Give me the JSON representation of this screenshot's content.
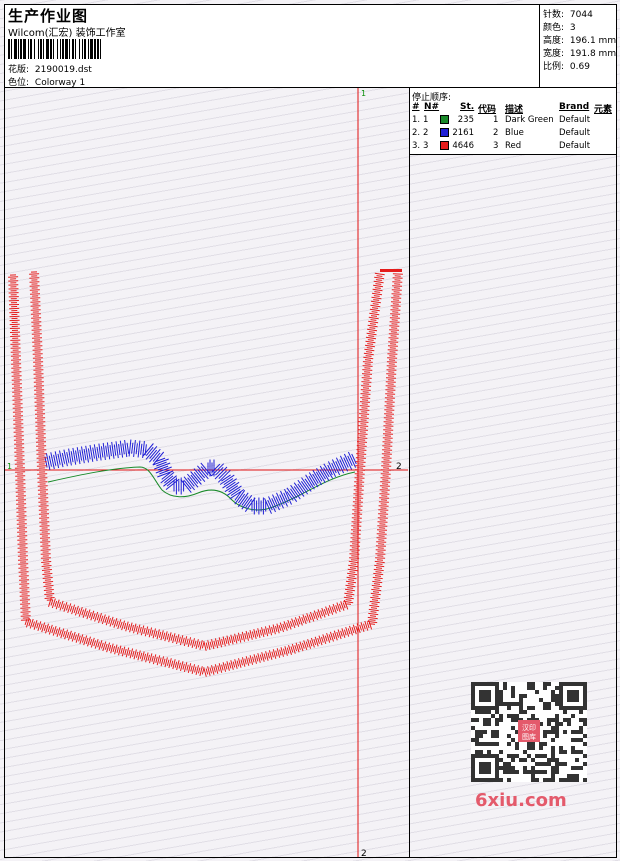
{
  "header": {
    "title": "生产作业图",
    "studio": "Wilcom(汇宏) 装饰工作室",
    "design_label": "花版:",
    "design_value": "2190019.dst",
    "colorway_label": "色位:",
    "colorway_value": "Colorway 1"
  },
  "stats": {
    "stitches_label": "针数:",
    "stitches_value": "7044",
    "colors_label": "颜色:",
    "colors_value": "3",
    "height_label": "高度:",
    "height_value": "196.1 mm",
    "width_label": "宽度:",
    "width_value": "191.8 mm",
    "scale_label": "比例:",
    "scale_value": "0.69"
  },
  "stop_sequence": {
    "title": "停止顺序:",
    "columns": {
      "index": "#",
      "needle": "N#",
      "stitches": "St.",
      "code": "代码",
      "description": "描述",
      "brand": "Brand",
      "element": "元素"
    },
    "rows": [
      {
        "index": "1.",
        "needle": "1",
        "color": "#1a8a2a",
        "stitches": "235",
        "code": "1",
        "description": "Dark Green",
        "brand": "Default"
      },
      {
        "index": "2.",
        "needle": "2",
        "color": "#1f1fd6",
        "stitches": "2161",
        "code": "2",
        "description": "Blue",
        "brand": "Default"
      },
      {
        "index": "3.",
        "needle": "3",
        "color": "#e41c1c",
        "stitches": "4646",
        "code": "3",
        "description": "Red",
        "brand": "Default"
      }
    ]
  },
  "axes": {
    "top_marker": "1",
    "bottom_marker": "2",
    "left_marker": "1",
    "right_marker": "2",
    "axis_color": "#e01010",
    "marker_color": "#0a8f0a"
  },
  "watermark": {
    "text": "6xiu.com",
    "seal_text": "汉印图库"
  }
}
